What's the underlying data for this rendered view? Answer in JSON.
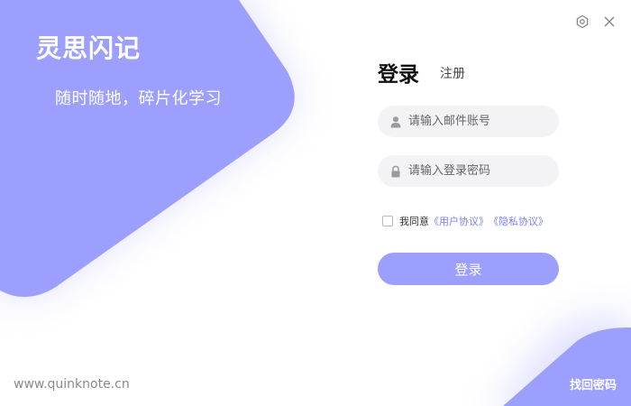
{
  "brand": {
    "title": "灵思闪记",
    "slogan": "随时随地，碎片化学习",
    "url": "www.quinknote.cn"
  },
  "window": {
    "settings_icon": "hexagon-settings-icon",
    "close_icon": "close-icon"
  },
  "tabs": {
    "login": "登录",
    "register": "注册"
  },
  "form": {
    "email": {
      "placeholder": "请输入邮件账号",
      "value": "",
      "icon": "user-icon"
    },
    "password": {
      "placeholder": "请输入登录密码",
      "value": "",
      "icon": "lock-icon"
    },
    "agree_prefix": "我同意",
    "user_agreement": "《用户协议》",
    "privacy_agreement": "《隐私协议》",
    "agree_checked": false,
    "submit_label": "登录"
  },
  "footer": {
    "forgot_password": "找回密码"
  },
  "colors": {
    "accent": "#9c9ffe",
    "link": "#7b7ff2",
    "field_bg": "#f3f3f5"
  }
}
